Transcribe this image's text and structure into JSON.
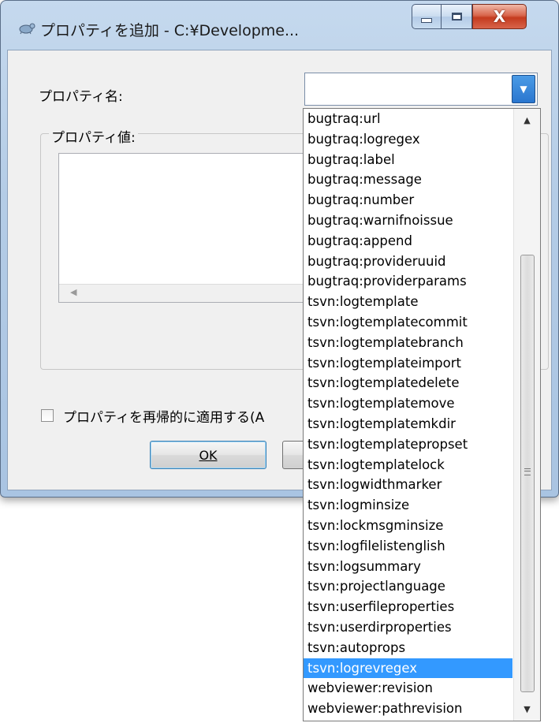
{
  "window": {
    "title": "プロパティを追加 - C:¥Developme...",
    "minimize_icon": "minimize-icon",
    "maximize_icon": "maximize-icon",
    "close_glyph": "X"
  },
  "form": {
    "property_name_label": "プロパティ名:",
    "property_name_value": "",
    "property_value_label": "プロパティ値:",
    "recursive_label": "プロパティを再帰的に適用する(A",
    "recursive_checked": false,
    "ok_label": "OK",
    "cancel_label": ""
  },
  "dropdown": {
    "items": [
      "bugtraq:url",
      "bugtraq:logregex",
      "bugtraq:label",
      "bugtraq:message",
      "bugtraq:number",
      "bugtraq:warnifnoissue",
      "bugtraq:append",
      "bugtraq:provideruuid",
      "bugtraq:providerparams",
      "tsvn:logtemplate",
      "tsvn:logtemplatecommit",
      "tsvn:logtemplatebranch",
      "tsvn:logtemplateimport",
      "tsvn:logtemplatedelete",
      "tsvn:logtemplatemove",
      "tsvn:logtemplatemkdir",
      "tsvn:logtemplatepropset",
      "tsvn:logtemplatelock",
      "tsvn:logwidthmarker",
      "tsvn:logminsize",
      "tsvn:lockmsgminsize",
      "tsvn:logfilelistenglish",
      "tsvn:logsummary",
      "tsvn:projectlanguage",
      "tsvn:userfileproperties",
      "tsvn:userdirproperties",
      "tsvn:autoprops",
      "tsvn:logrevregex",
      "webviewer:revision",
      "webviewer:pathrevision"
    ],
    "selected": "tsvn:logrevregex"
  },
  "colors": {
    "selection": "#3399ff",
    "window_frame": "#b4cce6",
    "close_button": "#c43b1f"
  }
}
